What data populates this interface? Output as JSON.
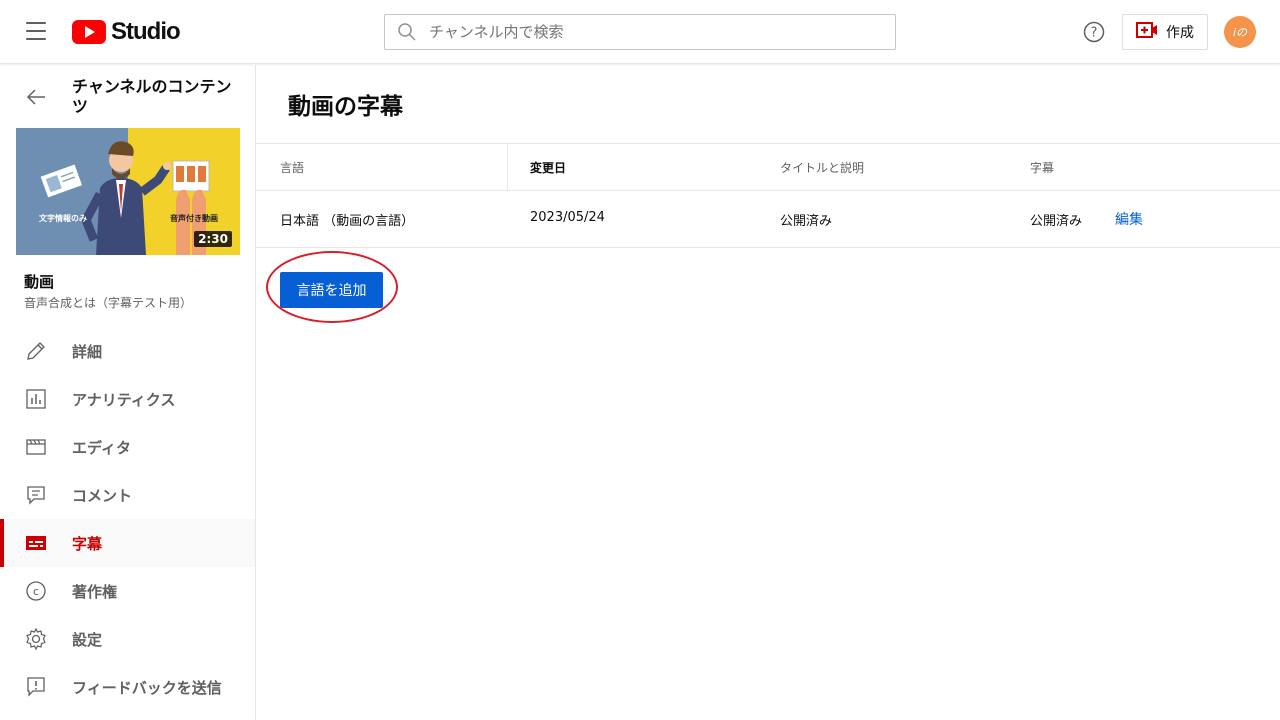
{
  "app": {
    "logo_text": "Studio",
    "brand_color": "#ff0000",
    "accent_color": "#065fd4",
    "active_color": "#cc0000"
  },
  "header": {
    "search_placeholder": "チャンネル内で検索",
    "create_label": "作成",
    "avatar_text": "iの"
  },
  "sidebar": {
    "back_title": "チャンネルのコンテンツ",
    "thumbnail": {
      "caption_left": "文字情報のみ",
      "caption_right": "音声付き動画",
      "duration": "2:30"
    },
    "video_title": "動画",
    "video_subtitle": "音声合成とは（字幕テスト用）",
    "items": [
      {
        "label": "詳細",
        "icon": "pencil-icon",
        "active": false
      },
      {
        "label": "アナリティクス",
        "icon": "analytics-icon",
        "active": false
      },
      {
        "label": "エディタ",
        "icon": "editor-icon",
        "active": false
      },
      {
        "label": "コメント",
        "icon": "comment-icon",
        "active": false
      },
      {
        "label": "字幕",
        "icon": "subtitles-icon",
        "active": true
      },
      {
        "label": "著作権",
        "icon": "copyright-icon",
        "active": false
      },
      {
        "label": "設定",
        "icon": "gear-icon",
        "active": false
      },
      {
        "label": "フィードバックを送信",
        "icon": "feedback-icon",
        "active": false
      }
    ]
  },
  "main": {
    "title": "動画の字幕",
    "columns": [
      "言語",
      "変更日",
      "タイトルと説明",
      "字幕"
    ],
    "rows": [
      {
        "language": "日本語 （動画の言語）",
        "modified": "2023/05/24",
        "title_desc": "公開済み",
        "subtitles": "公開済み",
        "action": "編集"
      }
    ],
    "add_language_button": "言語を追加"
  }
}
